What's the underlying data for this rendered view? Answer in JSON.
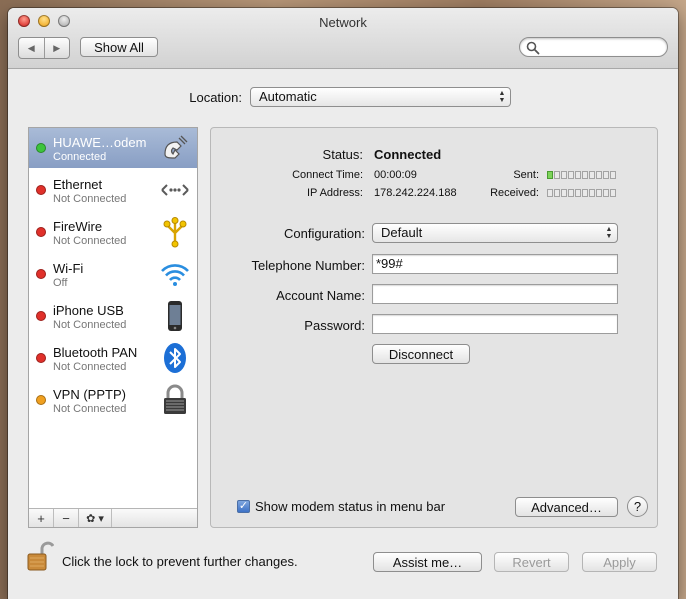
{
  "window": {
    "title": "Network"
  },
  "toolbar": {
    "back": "◀",
    "forward": "▶",
    "show_all": "Show All",
    "search_placeholder": ""
  },
  "location": {
    "label": "Location:",
    "value": "Automatic"
  },
  "services": [
    {
      "name": "HUAWE…odem",
      "status": "Connected",
      "dot": "#3cc43c",
      "icon": "modem-icon",
      "selected": true
    },
    {
      "name": "Ethernet",
      "status": "Not Connected",
      "dot": "#e0302a",
      "icon": "ethernet-icon"
    },
    {
      "name": "FireWire",
      "status": "Not Connected",
      "dot": "#e0302a",
      "icon": "firewire-icon"
    },
    {
      "name": "Wi-Fi",
      "status": "Off",
      "dot": "#e0302a",
      "icon": "wifi-icon"
    },
    {
      "name": "iPhone USB",
      "status": "Not Connected",
      "dot": "#e0302a",
      "icon": "iphone-icon"
    },
    {
      "name": "Bluetooth PAN",
      "status": "Not Connected",
      "dot": "#e0302a",
      "icon": "bluetooth-icon"
    },
    {
      "name": "VPN (PPTP)",
      "status": "Not Connected",
      "dot": "#f0a020",
      "icon": "vpn-lock-icon"
    }
  ],
  "sidebar_tools": {
    "add": "+",
    "remove": "−",
    "gear": "✿ ▾"
  },
  "status": {
    "label": "Status:",
    "value": "Connected",
    "connect_time_label": "Connect Time:",
    "connect_time": "00:00:09",
    "ip_label": "IP Address:",
    "ip": "178.242.224.188",
    "sent_label": "Sent:",
    "received_label": "Received:",
    "sent_level": 1,
    "received_level": 0,
    "meter_segments": 10
  },
  "form": {
    "configuration_label": "Configuration:",
    "configuration_value": "Default",
    "telephone_label": "Telephone Number:",
    "telephone_value": "*99#",
    "account_label": "Account Name:",
    "account_value": "",
    "password_label": "Password:",
    "password_value": "",
    "disconnect": "Disconnect"
  },
  "panel_footer": {
    "show_modem_label": "Show modem status in menu bar",
    "show_modem_checked": "✓",
    "advanced": "Advanced…",
    "help": "?"
  },
  "bottom": {
    "lock_text": "Click the lock to prevent further changes.",
    "assist": "Assist me…",
    "revert": "Revert",
    "apply": "Apply"
  },
  "colors": {
    "selected_row": "#889ec4",
    "green": "#3cc43c",
    "red": "#e0302a",
    "orange": "#f0a020"
  }
}
